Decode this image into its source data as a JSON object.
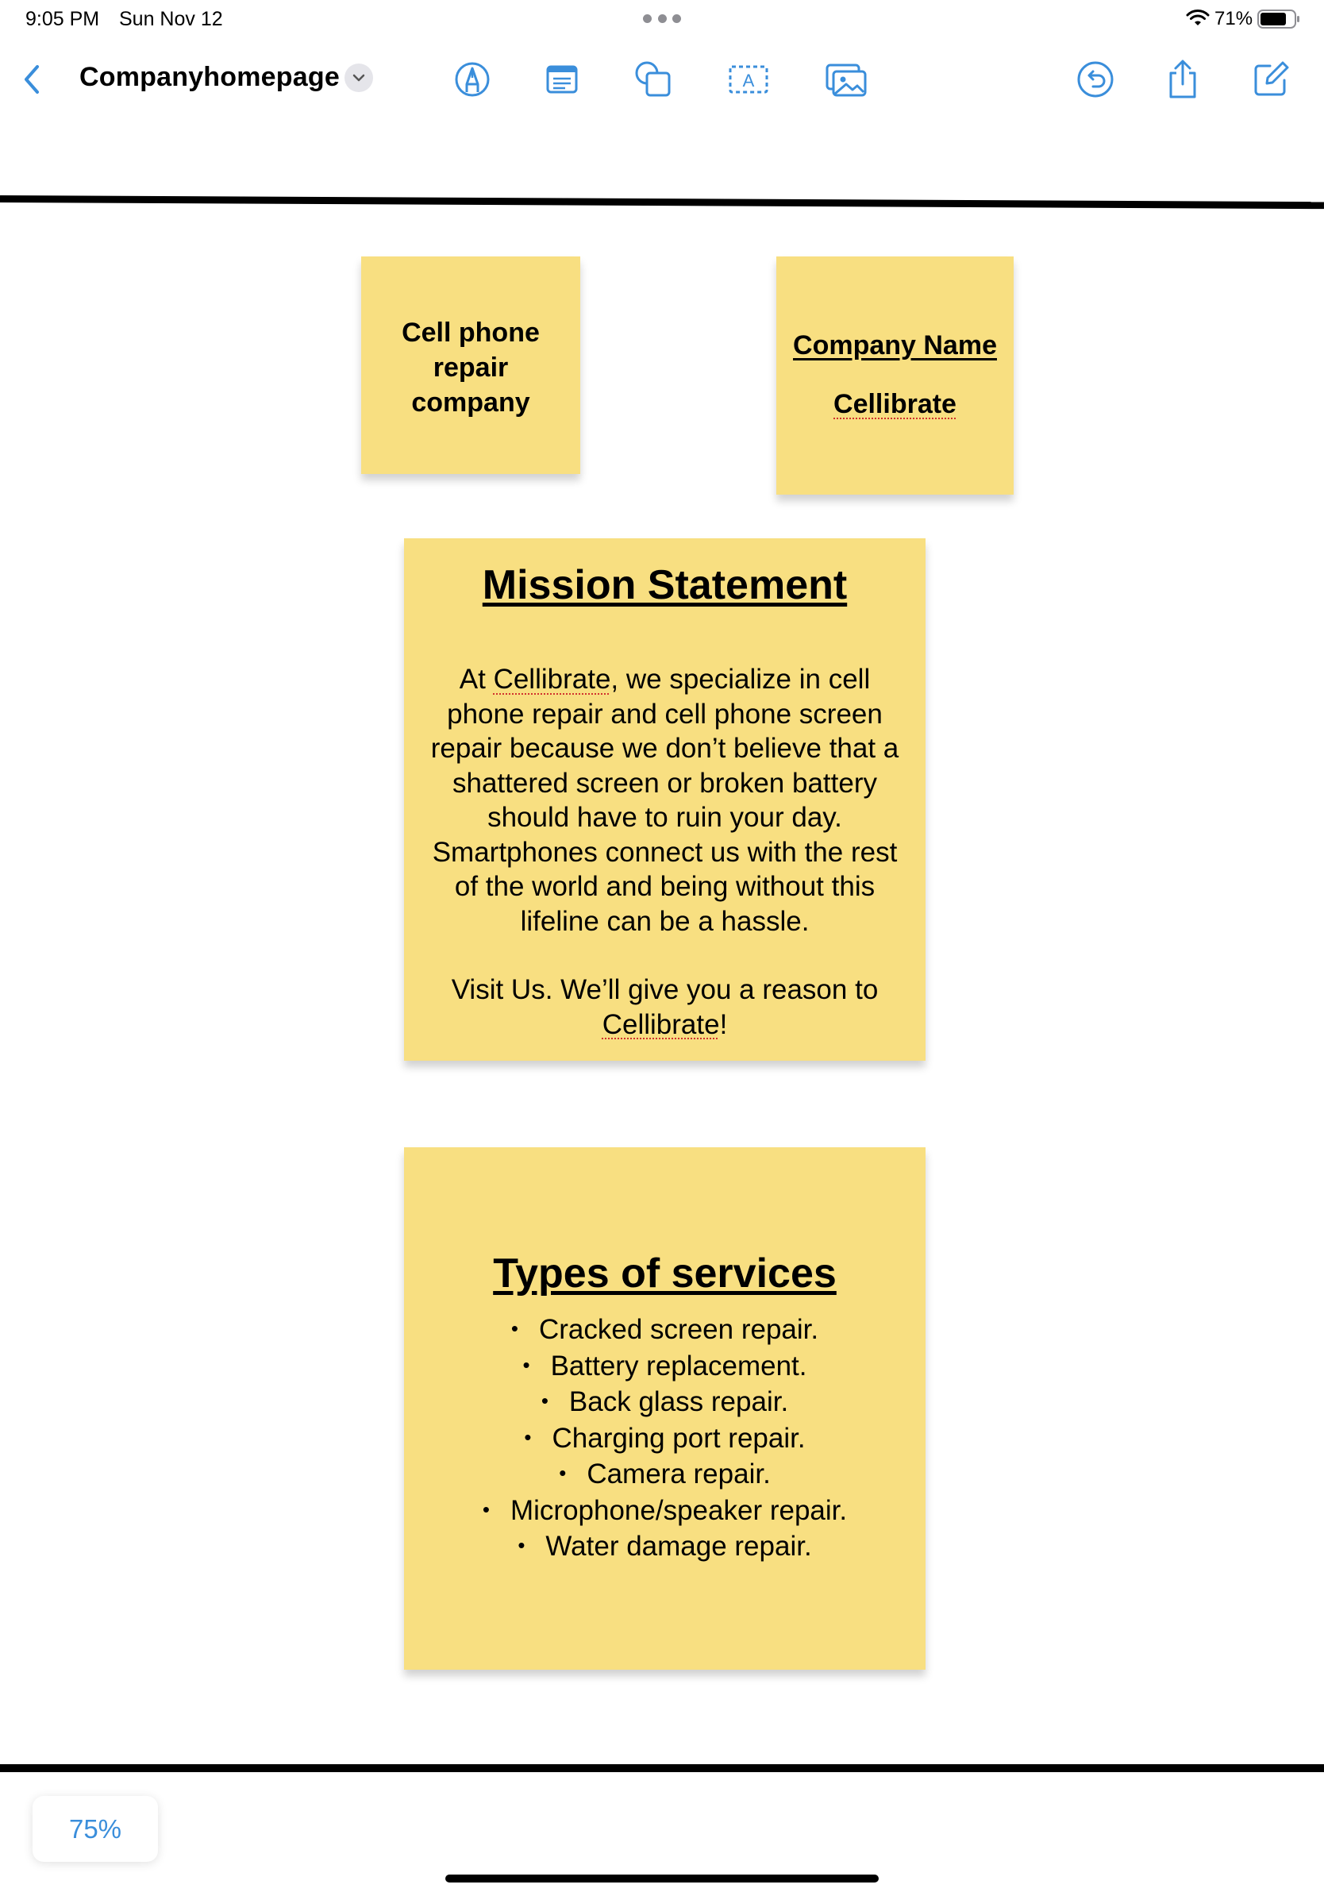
{
  "status_bar": {
    "time": "9:05 PM",
    "date": "Sun Nov 12",
    "battery_percent": "71%"
  },
  "toolbar": {
    "document_title": "Companyhomepage",
    "icons": [
      "back-icon",
      "chevron-down-icon",
      "pen-icon",
      "text-box-icon",
      "shapes-icon",
      "text-field-icon",
      "image-icon",
      "undo-icon",
      "share-icon",
      "new-board-icon"
    ],
    "accent_color": "#3a8edb"
  },
  "board": {
    "sticky_color": "#f8df81",
    "tagline_note": {
      "lines": [
        "Cell phone",
        "repair",
        "company"
      ]
    },
    "company_note": {
      "label": "Company Name",
      "name": "Cellibrate"
    },
    "mission_note": {
      "heading": "Mission Statement",
      "body_lines": [
        "At ",
        "Cellibrate",
        ", we specialize in cell",
        "phone repair and cell phone screen",
        "repair because we don’t believe that a",
        "shattered screen or broken battery",
        "should have to ruin your day.",
        "Smartphones connect us with the rest",
        "of the world and being without this",
        "lifeline can be a hassle."
      ],
      "closing_line_1": "Visit Us. We’ll give you a reason to",
      "closing_brand": "Cellibrate",
      "closing_punct": "!"
    },
    "services_note": {
      "heading": "Types of services",
      "items": [
        "Cracked screen repair.",
        "Battery replacement.",
        "Back glass repair.",
        "Charging port repair.",
        "Camera repair.",
        "Microphone/speaker repair.",
        "Water damage repair."
      ]
    }
  },
  "zoom": {
    "level": "75%"
  }
}
